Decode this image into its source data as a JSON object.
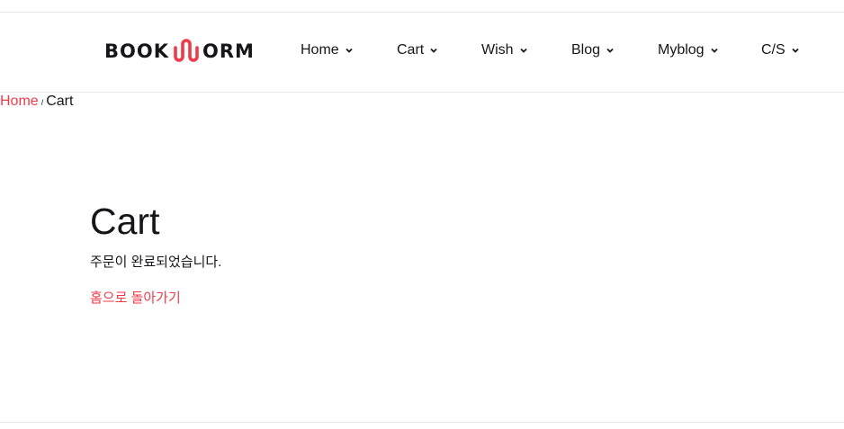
{
  "brand": {
    "logo_left": "BOOK",
    "logo_right": "ORM",
    "accent_color": "#ee3b48",
    "text_color": "#161619"
  },
  "nav": {
    "items": [
      {
        "label": "Home",
        "icon": "chevron-down-icon"
      },
      {
        "label": "Cart",
        "icon": "chevron-down-icon"
      },
      {
        "label": "Wish",
        "icon": "chevron-down-icon"
      },
      {
        "label": "Blog",
        "icon": "chevron-down-icon"
      },
      {
        "label": "Myblog",
        "icon": "chevron-down-icon"
      },
      {
        "label": "C/S",
        "icon": "chevron-down-icon"
      }
    ]
  },
  "breadcrumb": {
    "home": "Home",
    "separator": "/",
    "current": "Cart"
  },
  "main": {
    "title": "Cart",
    "message": "주문이 완료되었습니다.",
    "home_link": "홈으로 돌아가기"
  }
}
